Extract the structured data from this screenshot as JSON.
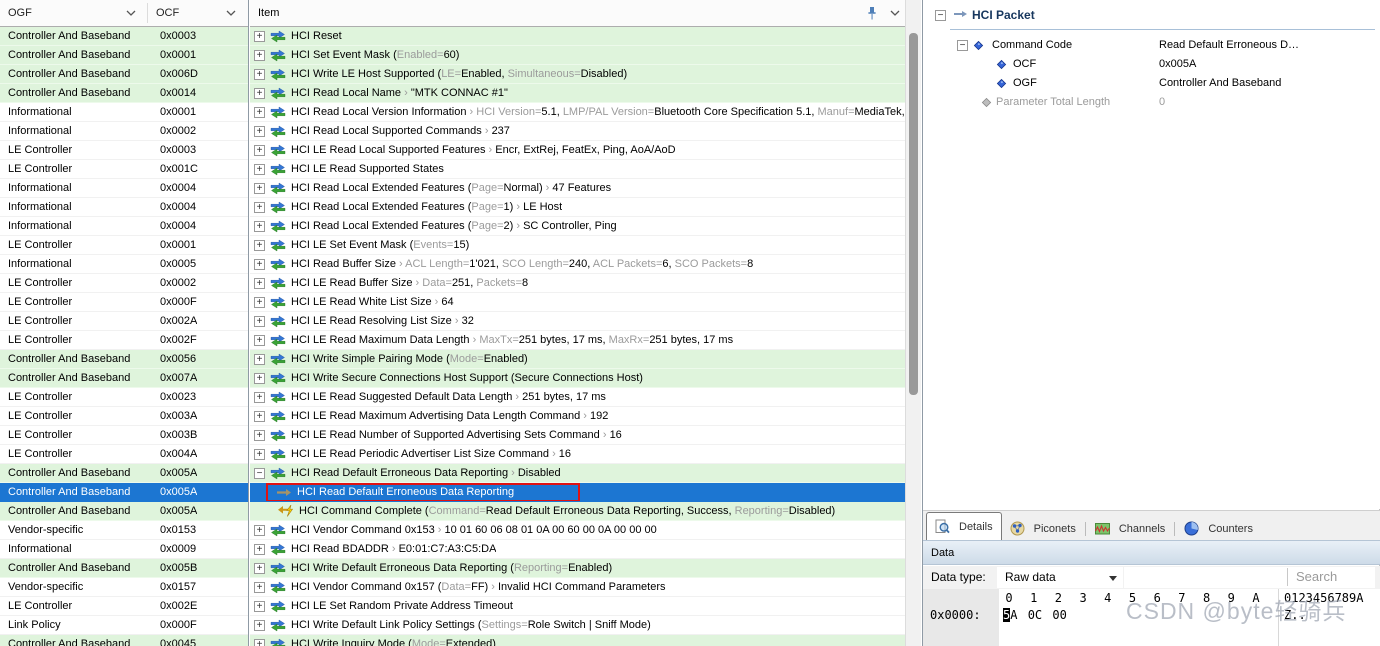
{
  "colors": {
    "selection_blue": "#1c76d2",
    "row_green": "#dff4dc",
    "annotation_red": "#e01212",
    "tree_title_navy": "#17375e",
    "gray_text": "#9b9b9b",
    "watermark_gray": "#9ea5b2"
  },
  "left_table": {
    "columns": [
      {
        "label": "OGF"
      },
      {
        "label": "OCF"
      }
    ],
    "rows": [
      {
        "ogf": "Controller And Baseband",
        "ocf": "0x0003",
        "bg": "green"
      },
      {
        "ogf": "Controller And Baseband",
        "ocf": "0x0001",
        "bg": "green"
      },
      {
        "ogf": "Controller And Baseband",
        "ocf": "0x006D",
        "bg": "green"
      },
      {
        "ogf": "Controller And Baseband",
        "ocf": "0x0014",
        "bg": "green"
      },
      {
        "ogf": "Informational",
        "ocf": "0x0001",
        "bg": "white"
      },
      {
        "ogf": "Informational",
        "ocf": "0x0002",
        "bg": "white"
      },
      {
        "ogf": "LE Controller",
        "ocf": "0x0003",
        "bg": "white"
      },
      {
        "ogf": "LE Controller",
        "ocf": "0x001C",
        "bg": "white"
      },
      {
        "ogf": "Informational",
        "ocf": "0x0004",
        "bg": "white"
      },
      {
        "ogf": "Informational",
        "ocf": "0x0004",
        "bg": "white"
      },
      {
        "ogf": "Informational",
        "ocf": "0x0004",
        "bg": "white"
      },
      {
        "ogf": "LE Controller",
        "ocf": "0x0001",
        "bg": "white"
      },
      {
        "ogf": "Informational",
        "ocf": "0x0005",
        "bg": "white"
      },
      {
        "ogf": "LE Controller",
        "ocf": "0x0002",
        "bg": "white"
      },
      {
        "ogf": "LE Controller",
        "ocf": "0x000F",
        "bg": "white"
      },
      {
        "ogf": "LE Controller",
        "ocf": "0x002A",
        "bg": "white"
      },
      {
        "ogf": "LE Controller",
        "ocf": "0x002F",
        "bg": "white"
      },
      {
        "ogf": "Controller And Baseband",
        "ocf": "0x0056",
        "bg": "green"
      },
      {
        "ogf": "Controller And Baseband",
        "ocf": "0x007A",
        "bg": "green"
      },
      {
        "ogf": "LE Controller",
        "ocf": "0x0023",
        "bg": "white"
      },
      {
        "ogf": "LE Controller",
        "ocf": "0x003A",
        "bg": "white"
      },
      {
        "ogf": "LE Controller",
        "ocf": "0x003B",
        "bg": "white"
      },
      {
        "ogf": "LE Controller",
        "ocf": "0x004A",
        "bg": "white"
      },
      {
        "ogf": "Controller And Baseband",
        "ocf": "0x005A",
        "bg": "green"
      },
      {
        "ogf": "Controller And Baseband",
        "ocf": "0x005A",
        "bg": "sel"
      },
      {
        "ogf": "Controller And Baseband",
        "ocf": "0x005A",
        "bg": "green"
      },
      {
        "ogf": "Vendor-specific",
        "ocf": "0x0153",
        "bg": "white"
      },
      {
        "ogf": "Informational",
        "ocf": "0x0009",
        "bg": "white"
      },
      {
        "ogf": "Controller And Baseband",
        "ocf": "0x005B",
        "bg": "green"
      },
      {
        "ogf": "Vendor-specific",
        "ocf": "0x0157",
        "bg": "white"
      },
      {
        "ogf": "LE Controller",
        "ocf": "0x002E",
        "bg": "white"
      },
      {
        "ogf": "Link Policy",
        "ocf": "0x000F",
        "bg": "white"
      },
      {
        "ogf": "Controller And Baseband",
        "ocf": "0x0045",
        "bg": "green"
      }
    ]
  },
  "item_list": {
    "header": "Item",
    "rows": [
      {
        "bg": "green",
        "expand": "+",
        "icon": "command-icon",
        "segs": [
          [
            "HCI Reset",
            "k"
          ]
        ]
      },
      {
        "bg": "green",
        "expand": "+",
        "icon": "command-icon",
        "segs": [
          [
            "HCI Set Event Mask (",
            "k"
          ],
          [
            "Enabled=",
            "g"
          ],
          [
            "60)",
            "k"
          ]
        ]
      },
      {
        "bg": "green",
        "expand": "+",
        "icon": "command-icon",
        "segs": [
          [
            "HCI Write LE Host Supported (",
            "k"
          ],
          [
            "LE=",
            "g"
          ],
          [
            "Enabled, ",
            "k"
          ],
          [
            "Simultaneous=",
            "g"
          ],
          [
            "Disabled)",
            "k"
          ]
        ]
      },
      {
        "bg": "green",
        "expand": "+",
        "icon": "command-icon",
        "segs": [
          [
            "HCI Read Local Name ",
            "k"
          ],
          [
            "› ",
            "g"
          ],
          [
            "\"MTK CONNAC #1\"",
            "k"
          ]
        ]
      },
      {
        "bg": "white",
        "expand": "+",
        "icon": "command-icon",
        "segs": [
          [
            "HCI Read Local Version Information ",
            "k"
          ],
          [
            "› ",
            "g"
          ],
          [
            "HCI Version=",
            "g"
          ],
          [
            "5.1, ",
            "k"
          ],
          [
            "LMP/PAL Version=",
            "g"
          ],
          [
            "Bluetooth Core Specification 5.1, ",
            "k"
          ],
          [
            "Manuf=",
            "g"
          ],
          [
            "MediaTek, …",
            "k"
          ]
        ]
      },
      {
        "bg": "white",
        "expand": "+",
        "icon": "command-icon",
        "segs": [
          [
            "HCI Read Local Supported Commands ",
            "k"
          ],
          [
            "› ",
            "g"
          ],
          [
            "237",
            "k"
          ]
        ]
      },
      {
        "bg": "white",
        "expand": "+",
        "icon": "command-icon",
        "segs": [
          [
            "HCI LE Read Local Supported Features ",
            "k"
          ],
          [
            "› ",
            "g"
          ],
          [
            "Encr, ExtRej, FeatEx, Ping, AoA/AoD",
            "k"
          ]
        ]
      },
      {
        "bg": "white",
        "expand": "+",
        "icon": "command-icon",
        "segs": [
          [
            "HCI LE Read Supported States",
            "k"
          ]
        ]
      },
      {
        "bg": "white",
        "expand": "+",
        "icon": "command-icon",
        "segs": [
          [
            "HCI Read Local Extended Features (",
            "k"
          ],
          [
            "Page=",
            "g"
          ],
          [
            "Normal) ",
            "k"
          ],
          [
            "› ",
            "g"
          ],
          [
            "47 Features",
            "k"
          ]
        ]
      },
      {
        "bg": "white",
        "expand": "+",
        "icon": "command-icon",
        "segs": [
          [
            "HCI Read Local Extended Features (",
            "k"
          ],
          [
            "Page=",
            "g"
          ],
          [
            "1) ",
            "k"
          ],
          [
            "› ",
            "g"
          ],
          [
            "LE Host",
            "k"
          ]
        ]
      },
      {
        "bg": "white",
        "expand": "+",
        "icon": "command-icon",
        "segs": [
          [
            "HCI Read Local Extended Features (",
            "k"
          ],
          [
            "Page=",
            "g"
          ],
          [
            "2) ",
            "k"
          ],
          [
            "› ",
            "g"
          ],
          [
            "SC Controller, Ping",
            "k"
          ]
        ]
      },
      {
        "bg": "white",
        "expand": "+",
        "icon": "command-icon",
        "segs": [
          [
            "HCI LE Set Event Mask (",
            "k"
          ],
          [
            "Events=",
            "g"
          ],
          [
            "15)",
            "k"
          ]
        ]
      },
      {
        "bg": "white",
        "expand": "+",
        "icon": "command-icon",
        "segs": [
          [
            "HCI Read Buffer Size ",
            "k"
          ],
          [
            "› ",
            "g"
          ],
          [
            "ACL Length=",
            "g"
          ],
          [
            "1'021, ",
            "k"
          ],
          [
            "SCO Length=",
            "g"
          ],
          [
            "240, ",
            "k"
          ],
          [
            "ACL Packets=",
            "g"
          ],
          [
            "6, ",
            "k"
          ],
          [
            "SCO Packets=",
            "g"
          ],
          [
            "8",
            "k"
          ]
        ]
      },
      {
        "bg": "white",
        "expand": "+",
        "icon": "command-icon",
        "segs": [
          [
            "HCI LE Read Buffer Size ",
            "k"
          ],
          [
            "› ",
            "g"
          ],
          [
            "Data=",
            "g"
          ],
          [
            "251, ",
            "k"
          ],
          [
            "Packets=",
            "g"
          ],
          [
            "8",
            "k"
          ]
        ]
      },
      {
        "bg": "white",
        "expand": "+",
        "icon": "command-icon",
        "segs": [
          [
            "HCI LE Read White List Size ",
            "k"
          ],
          [
            "› ",
            "g"
          ],
          [
            "64",
            "k"
          ]
        ]
      },
      {
        "bg": "white",
        "expand": "+",
        "icon": "command-icon",
        "segs": [
          [
            "HCI LE Read Resolving List Size ",
            "k"
          ],
          [
            "› ",
            "g"
          ],
          [
            "32",
            "k"
          ]
        ]
      },
      {
        "bg": "white",
        "expand": "+",
        "icon": "command-icon",
        "segs": [
          [
            "HCI LE Read Maximum Data Length ",
            "k"
          ],
          [
            "› ",
            "g"
          ],
          [
            "MaxTx=",
            "g"
          ],
          [
            "251 bytes, 17 ms, ",
            "k"
          ],
          [
            "MaxRx=",
            "g"
          ],
          [
            "251 bytes, 17 ms",
            "k"
          ]
        ]
      },
      {
        "bg": "green",
        "expand": "+",
        "icon": "command-icon",
        "segs": [
          [
            "HCI Write Simple Pairing Mode (",
            "k"
          ],
          [
            "Mode=",
            "g"
          ],
          [
            "Enabled)",
            "k"
          ]
        ]
      },
      {
        "bg": "green",
        "expand": "+",
        "icon": "command-icon",
        "segs": [
          [
            "HCI Write Secure Connections Host Support (Secure Connections Host)",
            "k"
          ]
        ]
      },
      {
        "bg": "white",
        "expand": "+",
        "icon": "command-icon",
        "segs": [
          [
            "HCI LE Read Suggested Default Data Length ",
            "k"
          ],
          [
            "› ",
            "g"
          ],
          [
            "251 bytes, 17 ms",
            "k"
          ]
        ]
      },
      {
        "bg": "white",
        "expand": "+",
        "icon": "command-icon",
        "segs": [
          [
            "HCI LE Read Maximum Advertising Data Length Command ",
            "k"
          ],
          [
            "› ",
            "g"
          ],
          [
            "192",
            "k"
          ]
        ]
      },
      {
        "bg": "white",
        "expand": "+",
        "icon": "command-icon",
        "segs": [
          [
            "HCI LE Read Number of Supported Advertising Sets Command ",
            "k"
          ],
          [
            "› ",
            "g"
          ],
          [
            "16",
            "k"
          ]
        ]
      },
      {
        "bg": "white",
        "expand": "+",
        "icon": "command-icon",
        "segs": [
          [
            "HCI LE Read Periodic Advertiser List Size Command ",
            "k"
          ],
          [
            "› ",
            "g"
          ],
          [
            "16",
            "k"
          ]
        ]
      },
      {
        "bg": "green",
        "expand": "-",
        "icon": "command-icon",
        "segs": [
          [
            "HCI Read Default Erroneous Data Reporting ",
            "k"
          ],
          [
            "› ",
            "g"
          ],
          [
            "Disabled",
            "k"
          ]
        ]
      },
      {
        "bg": "sel",
        "child": true,
        "icon": "sent-arrow-icon",
        "annotated": true,
        "segs": [
          [
            "HCI Read Default Erroneous Data Reporting",
            "w"
          ]
        ]
      },
      {
        "bg": "green",
        "child": true,
        "icon": "event-arrow-icon",
        "segs": [
          [
            "HCI Command Complete (",
            "k"
          ],
          [
            "Command=",
            "g"
          ],
          [
            "Read Default Erroneous Data Reporting, Success, ",
            "k"
          ],
          [
            "Reporting=",
            "g"
          ],
          [
            "Disabled)",
            "k"
          ]
        ]
      },
      {
        "bg": "white",
        "expand": "+",
        "icon": "command-icon",
        "segs": [
          [
            "HCI Vendor Command 0x153 ",
            "k"
          ],
          [
            "› ",
            "g"
          ],
          [
            "10 01 60 06 08 01 0A 00 60 00 0A 00 00 00",
            "k"
          ]
        ]
      },
      {
        "bg": "white",
        "expand": "+",
        "icon": "command-icon",
        "segs": [
          [
            "HCI Read BDADDR ",
            "k"
          ],
          [
            "› ",
            "g"
          ],
          [
            "E0:01:C7:A3:C5:DA",
            "k"
          ]
        ]
      },
      {
        "bg": "green",
        "expand": "+",
        "icon": "command-icon",
        "segs": [
          [
            "HCI Write Default Erroneous Data Reporting (",
            "k"
          ],
          [
            "Reporting=",
            "g"
          ],
          [
            "Enabled)",
            "k"
          ]
        ]
      },
      {
        "bg": "white",
        "expand": "+",
        "icon": "command-icon",
        "segs": [
          [
            "HCI Vendor Command 0x157 (",
            "k"
          ],
          [
            "Data=",
            "g"
          ],
          [
            "FF) ",
            "k"
          ],
          [
            "› ",
            "g"
          ],
          [
            "Invalid HCI Command Parameters",
            "k"
          ]
        ]
      },
      {
        "bg": "white",
        "expand": "+",
        "icon": "command-icon",
        "segs": [
          [
            "HCI LE Set Random Private Address Timeout",
            "k"
          ]
        ]
      },
      {
        "bg": "white",
        "expand": "+",
        "icon": "command-icon",
        "segs": [
          [
            "HCI Write Default Link Policy Settings (",
            "k"
          ],
          [
            "Settings=",
            "g"
          ],
          [
            "Role Switch | Sniff Mode)",
            "k"
          ]
        ]
      },
      {
        "bg": "green",
        "expand": "+",
        "icon": "command-icon",
        "segs": [
          [
            "HCI Write Inquiry Mode (",
            "k"
          ],
          [
            "Mode=",
            "g"
          ],
          [
            "Extended)",
            "k"
          ]
        ]
      }
    ]
  },
  "detail_tree": {
    "rows": [
      {
        "level": "lvl0",
        "expander": "-",
        "icon": "hci-packet-arrow-icon",
        "label": "HCI Packet",
        "value": "",
        "title": true
      },
      {
        "level": "lvl1",
        "expander": "-",
        "icon": "field-diamond-icon",
        "label": "Command Code",
        "value": "Read Default Erroneous D…"
      },
      {
        "level": "lvl2",
        "icon": "field-diamond-icon",
        "label": "OCF",
        "value": "0x005A"
      },
      {
        "level": "lvl2",
        "icon": "field-diamond-icon",
        "label": "OGF",
        "value": "Controller And Baseband"
      },
      {
        "level": "lvlp",
        "icon": "field-diamond-gray-icon",
        "label": "Parameter Total Length",
        "value": "0",
        "gray": true
      }
    ]
  },
  "tabs": [
    {
      "label": "Details",
      "icon": "details-icon",
      "active": true
    },
    {
      "label": "Piconets",
      "icon": "piconets-icon",
      "active": false
    },
    {
      "label": "Channels",
      "icon": "channels-icon",
      "active": false
    },
    {
      "label": "Counters",
      "icon": "counters-icon",
      "active": false
    }
  ],
  "data_panel": {
    "title": "Data",
    "data_type_label": "Data type:",
    "data_type_value": "Raw data",
    "search_placeholder": "Search",
    "hex": {
      "address": "0x0000:",
      "columns": [
        "0",
        "1",
        "2",
        "3",
        "4",
        "5",
        "6",
        "7",
        "8",
        "9",
        "A"
      ],
      "ascii_header": "0123456789A",
      "bytes": [
        "5A",
        "0C",
        "00"
      ],
      "ascii": "Z..",
      "cursor": {
        "byte_index": 0,
        "char_index": 0
      }
    }
  },
  "watermark": "CSDN @byte轻骑兵",
  "icons": {
    "command-icon": "blue right arrow over green left arrow (HCI command/response)",
    "sent-arrow-icon": "tan right arrow (host to controller)",
    "event-arrow-icon": "amber left arrow with yellow lightning bolt (event)",
    "hci-packet-arrow-icon": "blue-gray right arrow",
    "field-diamond-icon": "blue diamond",
    "field-diamond-gray-icon": "gray diamond",
    "pin-icon": "blue pushpin",
    "chevron-down-icon": "down chevron",
    "details-icon": "magnifier over document",
    "piconets-icon": "tan network sphere with blue nodes",
    "channels-icon": "green spectrum with red trace",
    "counters-icon": "blue pie chart",
    "dropdown-arrow-icon": "black down triangle"
  }
}
